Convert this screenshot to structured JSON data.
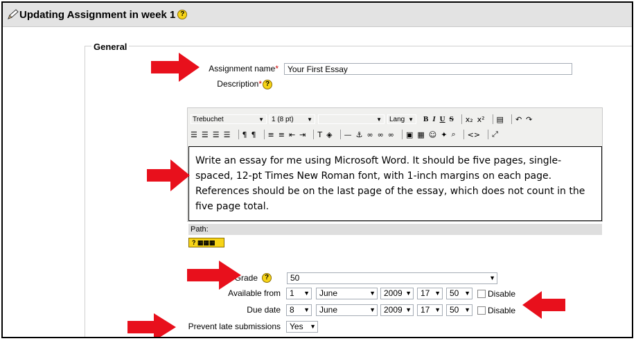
{
  "header": {
    "title": "Updating Assignment in week 1",
    "help": "?"
  },
  "fieldset": {
    "legend": "General"
  },
  "assignment_name": {
    "label": "Assignment name",
    "required": "*",
    "value": "Your First Essay"
  },
  "description": {
    "label": "Description",
    "required": "*"
  },
  "editor": {
    "font_family": "Trebuchet",
    "font_size": "1 (8 pt)",
    "format": "",
    "lang": "Lang",
    "content": "Write an essay for me using Microsoft Word. It should be five pages, single-spaced, 12-pt Times New Roman font, with 1-inch margins on each page. References should be on the last page of the essay, which does not count in the five page total.",
    "path_label": "Path:",
    "help_badge": "?"
  },
  "grade": {
    "label": "Grade",
    "value": "50"
  },
  "available_from": {
    "label": "Available from",
    "day": "1",
    "month": "June",
    "year": "2009",
    "hour": "17",
    "minute": "50",
    "disable_label": "Disable"
  },
  "due_date": {
    "label": "Due date",
    "day": "8",
    "month": "June",
    "year": "2009",
    "hour": "17",
    "minute": "50",
    "disable_label": "Disable"
  },
  "prevent_late": {
    "label": "Prevent late submissions",
    "value": "Yes"
  },
  "colors": {
    "title_bar": "#e3e3e3",
    "arrow": "#e8101c",
    "help_icon": "#f7d417",
    "required": "#cc0000"
  }
}
